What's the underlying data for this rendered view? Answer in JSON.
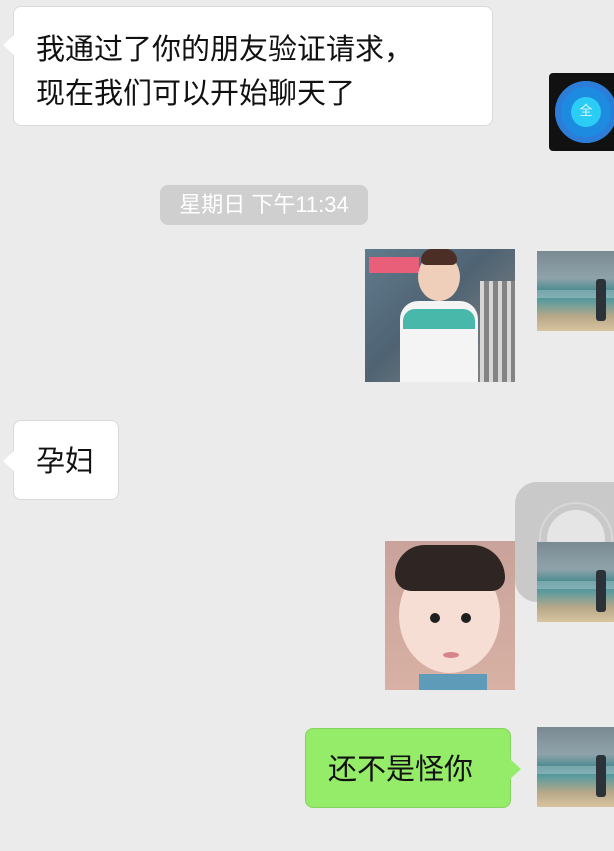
{
  "chat": {
    "incoming_1_line_1": "我通过了你的朋友验证请求，",
    "incoming_1_line_2": "现在我们可以开始聊天了",
    "timestamp": "星期日 下午11:34",
    "incoming_2": "孕妇",
    "outgoing_1": "还不是怪你"
  },
  "avatars": {
    "top_right_symbol": "全"
  },
  "colors": {
    "background": "#ebebeb",
    "incoming_bubble": "#ffffff",
    "outgoing_bubble": "#95ec69",
    "timestamp_badge": "#cfcfcf"
  }
}
